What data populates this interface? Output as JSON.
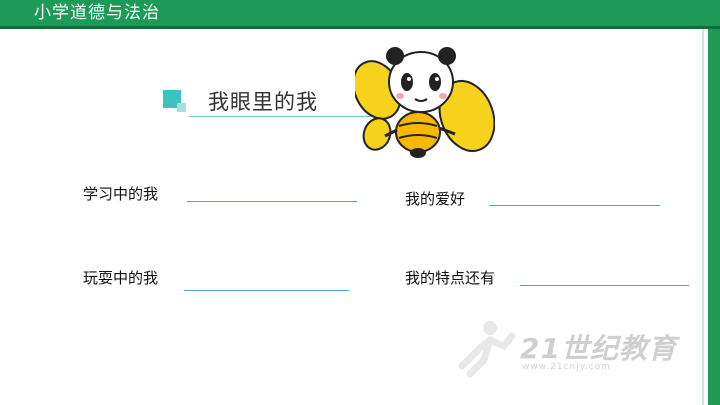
{
  "header": {
    "title": "小学道德与法治"
  },
  "section": {
    "title": "我眼里的我"
  },
  "prompts": [
    {
      "label": "学习中的我"
    },
    {
      "label": "我的爱好"
    },
    {
      "label": "玩耍中的我"
    },
    {
      "label": "我的特点还有"
    }
  ],
  "watermark": {
    "logo_text": "21世纪教育",
    "url_text": "www.21cnjy.com"
  },
  "colors": {
    "header_green": "#1f9a56",
    "accent_teal": "#3cc3c0",
    "line_blue": "#5a9fd4",
    "bee_yellow": "#f5c518"
  }
}
